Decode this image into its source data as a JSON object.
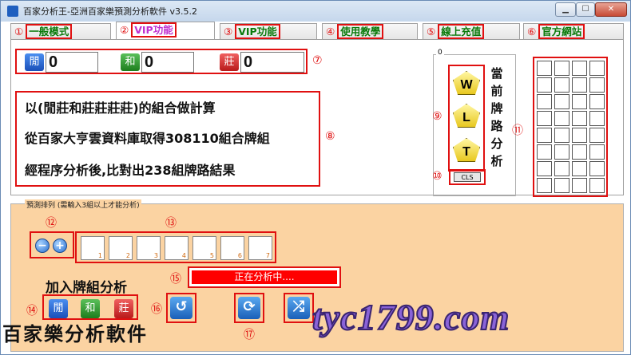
{
  "window": {
    "title": "百家分析王-亞洲百家樂預測分析軟件 v3.5.2",
    "minimize": "▁",
    "maximize": "☐",
    "close": "✕"
  },
  "tabs": [
    {
      "num": "①",
      "label": "一般模式"
    },
    {
      "num": "②",
      "label": "VIP功能"
    },
    {
      "num": "③",
      "label": "VIP功能"
    },
    {
      "num": "④",
      "label": "使用教學"
    },
    {
      "num": "⑤",
      "label": "線上充值"
    },
    {
      "num": "⑥",
      "label": "官方網站"
    }
  ],
  "counters": {
    "banker": {
      "icon": "閒",
      "value": "0"
    },
    "tie": {
      "icon": "和",
      "value": "0"
    },
    "player": {
      "icon": "莊",
      "value": "0"
    }
  },
  "markers": {
    "m7": "⑦",
    "m8": "⑧",
    "m9": "⑨",
    "m10": "⑩",
    "m11": "⑪",
    "m12": "⑫",
    "m13": "⑬",
    "m14": "⑭",
    "m15": "⑮",
    "m16": "⑯",
    "m17": "⑰"
  },
  "info": {
    "line1": "以(閒莊和莊莊莊莊)的組合做計算",
    "line2": "從百家大亨雲資料庫取得308110組合牌組",
    "line3": "經程序分析後,比對出238組牌路結果"
  },
  "trend": {
    "group_label": "0",
    "badges": [
      "W",
      "L",
      "T"
    ],
    "vertical_text": [
      "當",
      "前",
      "牌",
      "路",
      "分",
      "析"
    ],
    "cls_label": "CLS"
  },
  "predict": {
    "legend": "預測排列 (需輸入3組以上才能分析)",
    "minus": "−",
    "plus": "+",
    "slots": [
      "1",
      "2",
      "3",
      "4",
      "5",
      "6",
      "7"
    ],
    "add_label": "加入牌組分析",
    "add_buttons": [
      "閒",
      "和",
      "莊"
    ],
    "status": "正在分析中...."
  },
  "actions": {
    "undo": "↺",
    "refresh": "⟳",
    "shuffle": "⤮"
  },
  "footer": {
    "left": "百家樂分析軟件",
    "right": "tyc1799.com"
  }
}
